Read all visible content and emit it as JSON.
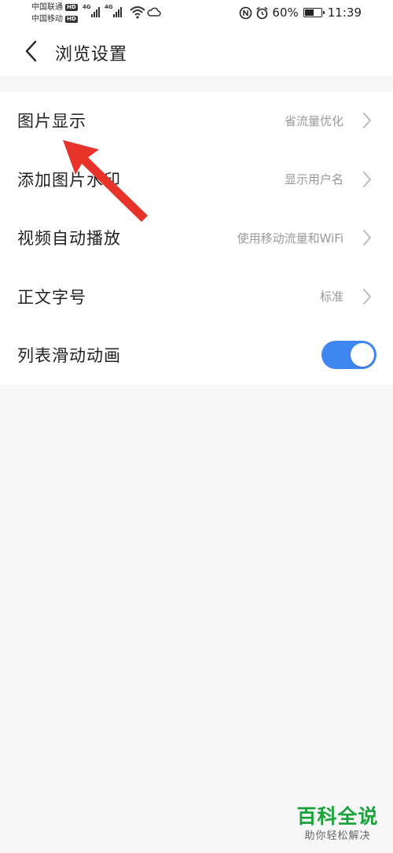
{
  "status_bar": {
    "carriers": [
      {
        "name": "中国联通",
        "badge": "HD"
      },
      {
        "name": "中国移动",
        "badge": "HD"
      }
    ],
    "network_tags": [
      "4G",
      "4G"
    ],
    "battery_percent": "60%",
    "battery_level": 0.6,
    "time": "11:39",
    "icons": [
      "signal-icon",
      "wifi-icon",
      "cloud-icon",
      "nfc-icon",
      "alarm-icon",
      "battery-icon"
    ]
  },
  "header": {
    "title": "浏览设置",
    "back_icon": "chevron-left-icon"
  },
  "settings": [
    {
      "label": "图片显示",
      "value": "省流量优化"
    },
    {
      "label": "添加图片水印",
      "value": "显示用户名"
    },
    {
      "label": "视频自动播放",
      "value": "使用移动流量和WiFi"
    },
    {
      "label": "正文字号",
      "value": "标准"
    },
    {
      "label": "列表滑动动画",
      "toggle_on": true
    }
  ],
  "colors": {
    "accent": "#3e86f0",
    "arrow": "#e8332a",
    "watermark": "#1aa33a",
    "background": "#f7f7f7"
  },
  "watermark": {
    "title": "百科全说",
    "subtitle": "助你轻松解决"
  }
}
